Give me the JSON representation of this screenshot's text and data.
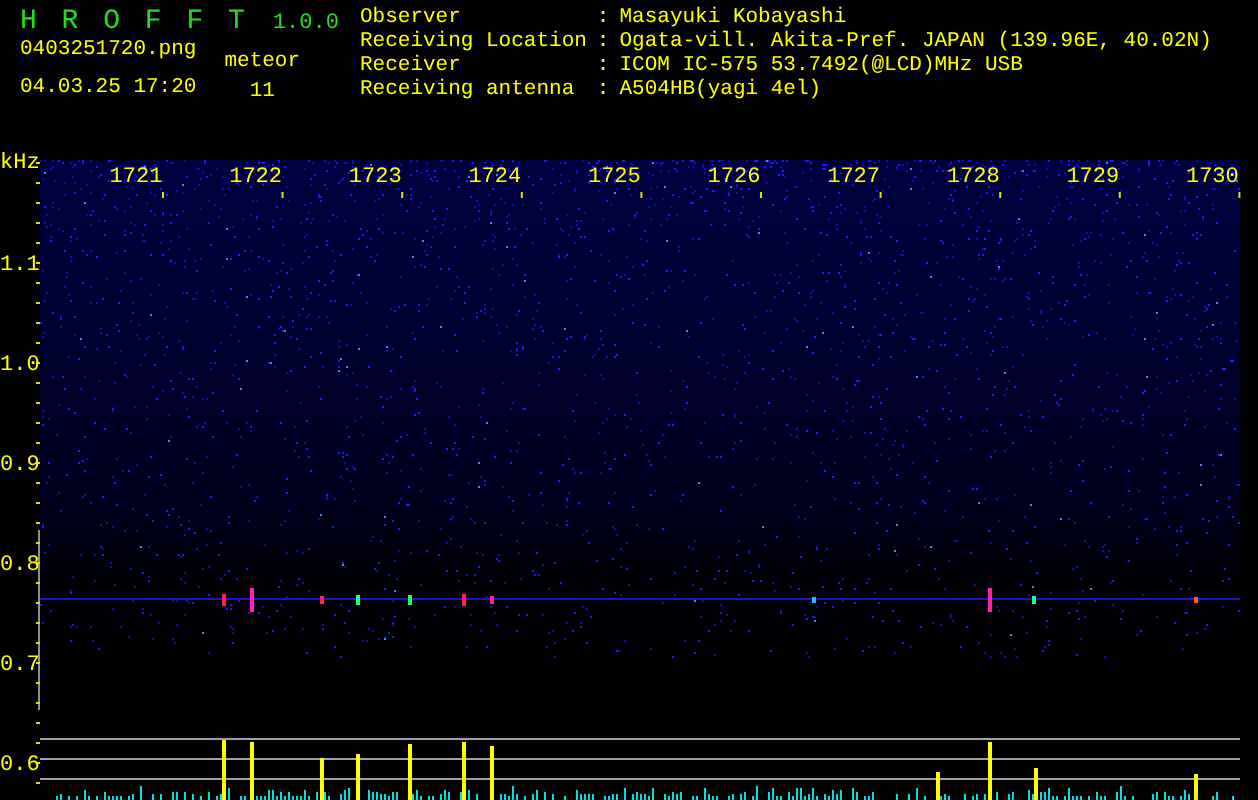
{
  "app": {
    "name": "H R O F F T",
    "version": "1.0.0"
  },
  "file_name": "0403251720.png",
  "date_time": "04.03.25 17:20",
  "meteor": {
    "label": "meteor",
    "count": "11"
  },
  "station_info": [
    {
      "label": "Observer",
      "separator": ":",
      "value": "Masayuki Kobayashi"
    },
    {
      "label": "Receiving Location",
      "separator": ":",
      "value": "Ogata-vill. Akita-Pref. JAPAN (139.96E, 40.02N)"
    },
    {
      "label": "Receiver",
      "separator": ":",
      "value": "ICOM IC-575 53.7492(@LCD)MHz USB"
    },
    {
      "label": "Receiving antenna",
      "separator": ":",
      "value": "A504HB(yagi 4el)"
    }
  ],
  "plot": {
    "unit_label": "kHz",
    "time_labels": [
      "1721",
      "1722",
      "1723",
      "1724",
      "1725",
      "1726",
      "1727",
      "1728",
      "1729",
      "1730"
    ],
    "frequency_labels": [
      "1.1",
      "1.0",
      "0.9",
      "0.8",
      "0.7",
      "0.6"
    ]
  }
}
